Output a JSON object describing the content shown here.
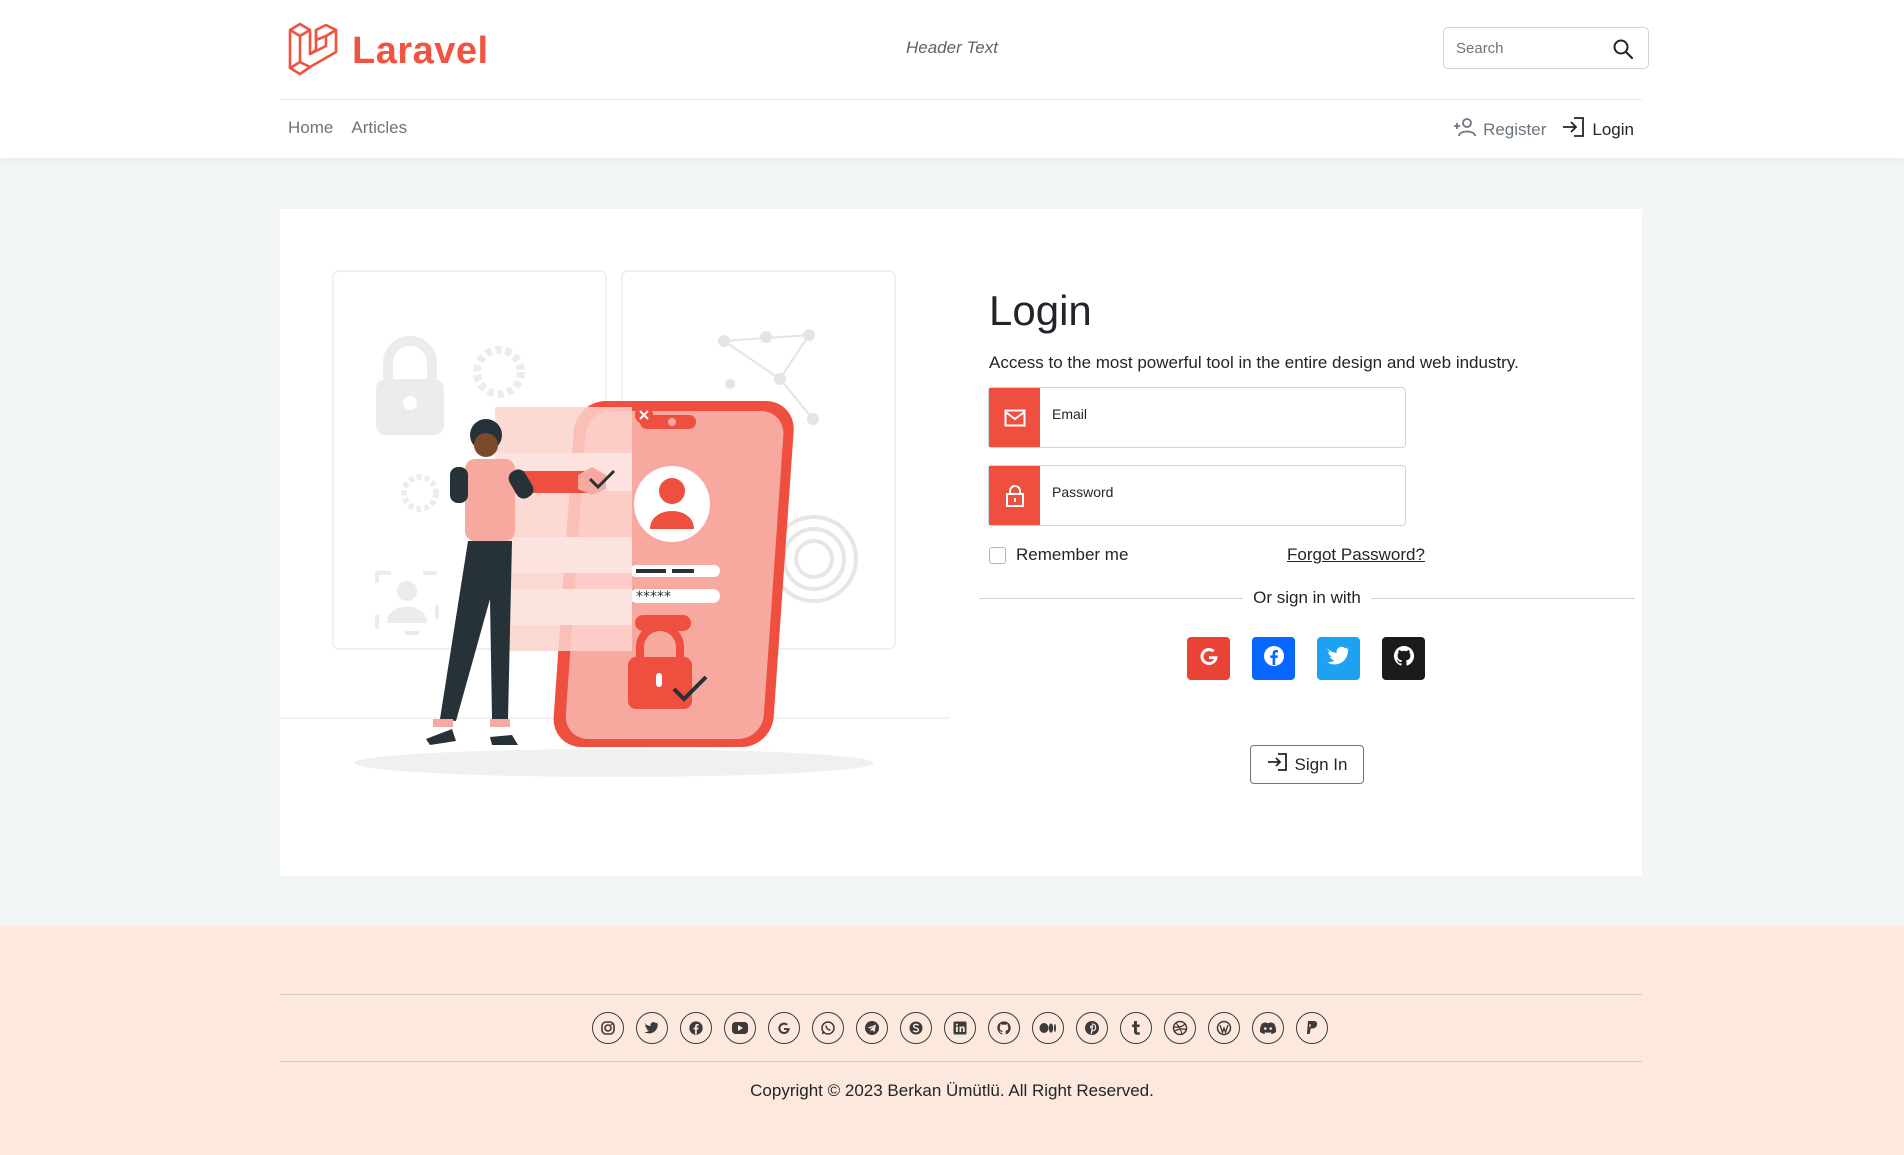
{
  "header": {
    "logo_text": "Laravel",
    "header_text": "Header Text",
    "search_placeholder": "Search"
  },
  "nav": {
    "items": [
      "Home",
      "Articles"
    ]
  },
  "auth": {
    "register": "Register",
    "login": "Login"
  },
  "login": {
    "title": "Login",
    "subtitle": "Access to the most powerful tool in the entire design and web industry.",
    "email_label": "Email",
    "password_label": "Password",
    "remember": "Remember me",
    "forgot": "Forgot Password?",
    "or_text": "Or sign in with",
    "signin_label": "Sign In",
    "social": [
      {
        "name": "google",
        "color": "#ea4335"
      },
      {
        "name": "facebook",
        "color": "#0866ff"
      },
      {
        "name": "twitter",
        "color": "#1da1f2"
      },
      {
        "name": "github",
        "color": "#1b1b1b"
      }
    ]
  },
  "footer": {
    "icons": [
      "instagram-icon",
      "twitter-icon",
      "facebook-icon",
      "youtube-icon",
      "google-icon",
      "whatsapp-icon",
      "telegram-icon",
      "skype-icon",
      "linkedin-icon",
      "github-icon",
      "medium-icon",
      "pinterest-icon",
      "tumblr-icon",
      "dribbble-icon",
      "wordpress-icon",
      "discord-icon",
      "paypal-icon"
    ],
    "copyright": "Copyright © 2023 Berkan Ümütlü. All Right Reserved."
  },
  "colors": {
    "accent": "#f05340",
    "footer_bg": "#fde8dd",
    "page_bg": "#f3f6f7"
  }
}
